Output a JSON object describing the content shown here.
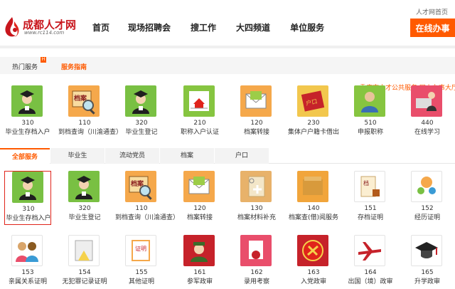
{
  "header": {
    "site_title": "成都人才网",
    "site_url": "www.rc114.com",
    "home_link": "人才网首页",
    "online_button": "在线办事",
    "nav": [
      "首页",
      "现场招聘会",
      "搜工作",
      "大四频道",
      "单位服务"
    ]
  },
  "section1": {
    "tab_hot": "热门服务",
    "tab_guide": "服务指南",
    "marquee": "重庆市人才公共服务 网上办事大厅",
    "cards": [
      {
        "num": "310",
        "label": "毕业生存档入户",
        "icon": "graduate-icon"
      },
      {
        "num": "110",
        "label": "到档查询（川渝通查）",
        "icon": "archive-search-icon"
      },
      {
        "num": "320",
        "label": "毕业生登记",
        "icon": "graduate-icon"
      },
      {
        "num": "210",
        "label": "职称入户认证",
        "icon": "house-certify-icon"
      },
      {
        "num": "120",
        "label": "档案转接",
        "icon": "envelope-icon"
      },
      {
        "num": "230",
        "label": "集体户户籍卡借出",
        "icon": "household-book-icon"
      },
      {
        "num": "510",
        "label": "申报职称",
        "icon": "person-icon"
      },
      {
        "num": "440",
        "label": "在线学习",
        "icon": "online-study-icon"
      }
    ]
  },
  "section2": {
    "tabs": [
      "全部服务",
      "毕业生",
      "流动党员",
      "档案",
      "户口"
    ],
    "cards_row1": [
      {
        "num": "310",
        "label": "毕业生存档入户",
        "icon": "graduate-icon"
      },
      {
        "num": "320",
        "label": "毕业生登记",
        "icon": "graduate-icon"
      },
      {
        "num": "110",
        "label": "到档查询（川渝通查）",
        "icon": "archive-search-icon"
      },
      {
        "num": "120",
        "label": "档案转接",
        "icon": "envelope-icon"
      },
      {
        "num": "130",
        "label": "档案材料补充",
        "icon": "folder-plus-icon"
      },
      {
        "num": "140",
        "label": "档案查(借)阅服务",
        "icon": "archive-folder-icon"
      },
      {
        "num": "151",
        "label": "存档证明",
        "icon": "document-stamp-icon"
      },
      {
        "num": "152",
        "label": "经历证明",
        "icon": "people-hands-icon"
      }
    ],
    "cards_row2": [
      {
        "num": "153",
        "label": "亲属关系证明",
        "icon": "family-icon"
      },
      {
        "num": "154",
        "label": "无犯罪记录证明",
        "icon": "no-crime-icon"
      },
      {
        "num": "155",
        "label": "其他证明",
        "icon": "certificate-icon"
      },
      {
        "num": "161",
        "label": "参军政审",
        "icon": "soldier-icon"
      },
      {
        "num": "162",
        "label": "录用考察",
        "icon": "award-doc-icon"
      },
      {
        "num": "163",
        "label": "入党政审",
        "icon": "party-emblem-icon"
      },
      {
        "num": "164",
        "label": "出国（境）政审",
        "icon": "airplane-icon"
      },
      {
        "num": "165",
        "label": "升学政审",
        "icon": "graduation-cap-icon"
      }
    ]
  }
}
